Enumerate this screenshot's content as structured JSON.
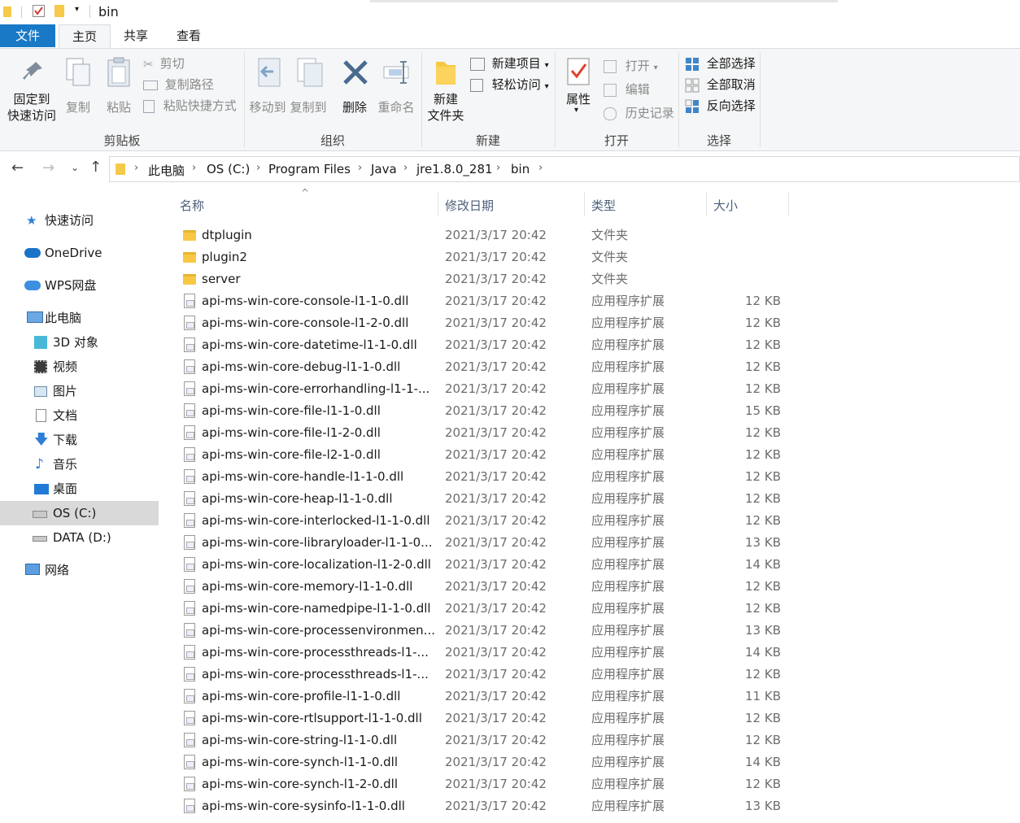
{
  "window": {
    "title": "bin"
  },
  "tabs": {
    "file": "文件",
    "home": "主页",
    "share": "共享",
    "view": "查看"
  },
  "ribbon": {
    "clipboard": {
      "pin": "固定到\n快速访问",
      "pin_l1": "固定到",
      "pin_l2": "快速访问",
      "copy": "复制",
      "paste": "粘贴",
      "cut": "剪切",
      "copy_path": "复制路径",
      "paste_shortcut": "粘贴快捷方式",
      "label": "剪贴板"
    },
    "organize": {
      "move_to": "移动到",
      "copy_to": "复制到",
      "delete": "删除",
      "rename": "重命名",
      "label": "组织"
    },
    "new": {
      "new_folder_l1": "新建",
      "new_folder_l2": "文件夹",
      "new_item": "新建项目",
      "easy_access": "轻松访问",
      "label": "新建"
    },
    "open": {
      "properties": "属性",
      "open": "打开",
      "edit": "编辑",
      "history": "历史记录",
      "label": "打开"
    },
    "select": {
      "select_all": "全部选择",
      "select_none": "全部取消",
      "invert": "反向选择",
      "label": "选择"
    }
  },
  "address": {
    "crumbs": [
      "此电脑",
      "OS (C:)",
      "Program Files",
      "Java",
      "jre1.8.0_281",
      "bin"
    ]
  },
  "nav": [
    {
      "label": "快速访问",
      "icon": "star-icon"
    },
    {
      "label": "OneDrive",
      "icon": "cloud-icon"
    },
    {
      "label": "WPS网盘",
      "icon": "cloud-icon"
    },
    {
      "label": "此电脑",
      "icon": "computer-icon"
    },
    {
      "label": "3D 对象",
      "icon": "cube-icon"
    },
    {
      "label": "视频",
      "icon": "video-icon"
    },
    {
      "label": "图片",
      "icon": "picture-icon"
    },
    {
      "label": "文档",
      "icon": "document-icon"
    },
    {
      "label": "下载",
      "icon": "download-icon"
    },
    {
      "label": "音乐",
      "icon": "music-icon"
    },
    {
      "label": "桌面",
      "icon": "desktop-icon"
    },
    {
      "label": "OS (C:)",
      "icon": "drive-icon"
    },
    {
      "label": "DATA (D:)",
      "icon": "drive-icon"
    },
    {
      "label": "网络",
      "icon": "network-icon"
    }
  ],
  "columns": {
    "name": "名称",
    "date": "修改日期",
    "type": "类型",
    "size": "大小"
  },
  "files": [
    {
      "name": "dtplugin",
      "date": "2021/3/17 20:42",
      "type": "文件夹",
      "size": "",
      "folder": true
    },
    {
      "name": "plugin2",
      "date": "2021/3/17 20:42",
      "type": "文件夹",
      "size": "",
      "folder": true
    },
    {
      "name": "server",
      "date": "2021/3/17 20:42",
      "type": "文件夹",
      "size": "",
      "folder": true
    },
    {
      "name": "api-ms-win-core-console-l1-1-0.dll",
      "date": "2021/3/17 20:42",
      "type": "应用程序扩展",
      "size": "12 KB"
    },
    {
      "name": "api-ms-win-core-console-l1-2-0.dll",
      "date": "2021/3/17 20:42",
      "type": "应用程序扩展",
      "size": "12 KB"
    },
    {
      "name": "api-ms-win-core-datetime-l1-1-0.dll",
      "date": "2021/3/17 20:42",
      "type": "应用程序扩展",
      "size": "12 KB"
    },
    {
      "name": "api-ms-win-core-debug-l1-1-0.dll",
      "date": "2021/3/17 20:42",
      "type": "应用程序扩展",
      "size": "12 KB"
    },
    {
      "name": "api-ms-win-core-errorhandling-l1-1-...",
      "date": "2021/3/17 20:42",
      "type": "应用程序扩展",
      "size": "12 KB"
    },
    {
      "name": "api-ms-win-core-file-l1-1-0.dll",
      "date": "2021/3/17 20:42",
      "type": "应用程序扩展",
      "size": "15 KB"
    },
    {
      "name": "api-ms-win-core-file-l1-2-0.dll",
      "date": "2021/3/17 20:42",
      "type": "应用程序扩展",
      "size": "12 KB"
    },
    {
      "name": "api-ms-win-core-file-l2-1-0.dll",
      "date": "2021/3/17 20:42",
      "type": "应用程序扩展",
      "size": "12 KB"
    },
    {
      "name": "api-ms-win-core-handle-l1-1-0.dll",
      "date": "2021/3/17 20:42",
      "type": "应用程序扩展",
      "size": "12 KB"
    },
    {
      "name": "api-ms-win-core-heap-l1-1-0.dll",
      "date": "2021/3/17 20:42",
      "type": "应用程序扩展",
      "size": "12 KB"
    },
    {
      "name": "api-ms-win-core-interlocked-l1-1-0.dll",
      "date": "2021/3/17 20:42",
      "type": "应用程序扩展",
      "size": "12 KB"
    },
    {
      "name": "api-ms-win-core-libraryloader-l1-1-0...",
      "date": "2021/3/17 20:42",
      "type": "应用程序扩展",
      "size": "13 KB"
    },
    {
      "name": "api-ms-win-core-localization-l1-2-0.dll",
      "date": "2021/3/17 20:42",
      "type": "应用程序扩展",
      "size": "14 KB"
    },
    {
      "name": "api-ms-win-core-memory-l1-1-0.dll",
      "date": "2021/3/17 20:42",
      "type": "应用程序扩展",
      "size": "12 KB"
    },
    {
      "name": "api-ms-win-core-namedpipe-l1-1-0.dll",
      "date": "2021/3/17 20:42",
      "type": "应用程序扩展",
      "size": "12 KB"
    },
    {
      "name": "api-ms-win-core-processenvironmen...",
      "date": "2021/3/17 20:42",
      "type": "应用程序扩展",
      "size": "13 KB"
    },
    {
      "name": "api-ms-win-core-processthreads-l1-...",
      "date": "2021/3/17 20:42",
      "type": "应用程序扩展",
      "size": "14 KB"
    },
    {
      "name": "api-ms-win-core-processthreads-l1-...",
      "date": "2021/3/17 20:42",
      "type": "应用程序扩展",
      "size": "12 KB"
    },
    {
      "name": "api-ms-win-core-profile-l1-1-0.dll",
      "date": "2021/3/17 20:42",
      "type": "应用程序扩展",
      "size": "11 KB"
    },
    {
      "name": "api-ms-win-core-rtlsupport-l1-1-0.dll",
      "date": "2021/3/17 20:42",
      "type": "应用程序扩展",
      "size": "12 KB"
    },
    {
      "name": "api-ms-win-core-string-l1-1-0.dll",
      "date": "2021/3/17 20:42",
      "type": "应用程序扩展",
      "size": "12 KB"
    },
    {
      "name": "api-ms-win-core-synch-l1-1-0.dll",
      "date": "2021/3/17 20:42",
      "type": "应用程序扩展",
      "size": "14 KB"
    },
    {
      "name": "api-ms-win-core-synch-l1-2-0.dll",
      "date": "2021/3/17 20:42",
      "type": "应用程序扩展",
      "size": "12 KB"
    },
    {
      "name": "api-ms-win-core-sysinfo-l1-1-0.dll",
      "date": "2021/3/17 20:42",
      "type": "应用程序扩展",
      "size": "13 KB"
    }
  ],
  "colors": {
    "accent": "#1979c6",
    "selected_nav": "#d9d9d9",
    "folder": "#f8c844"
  }
}
